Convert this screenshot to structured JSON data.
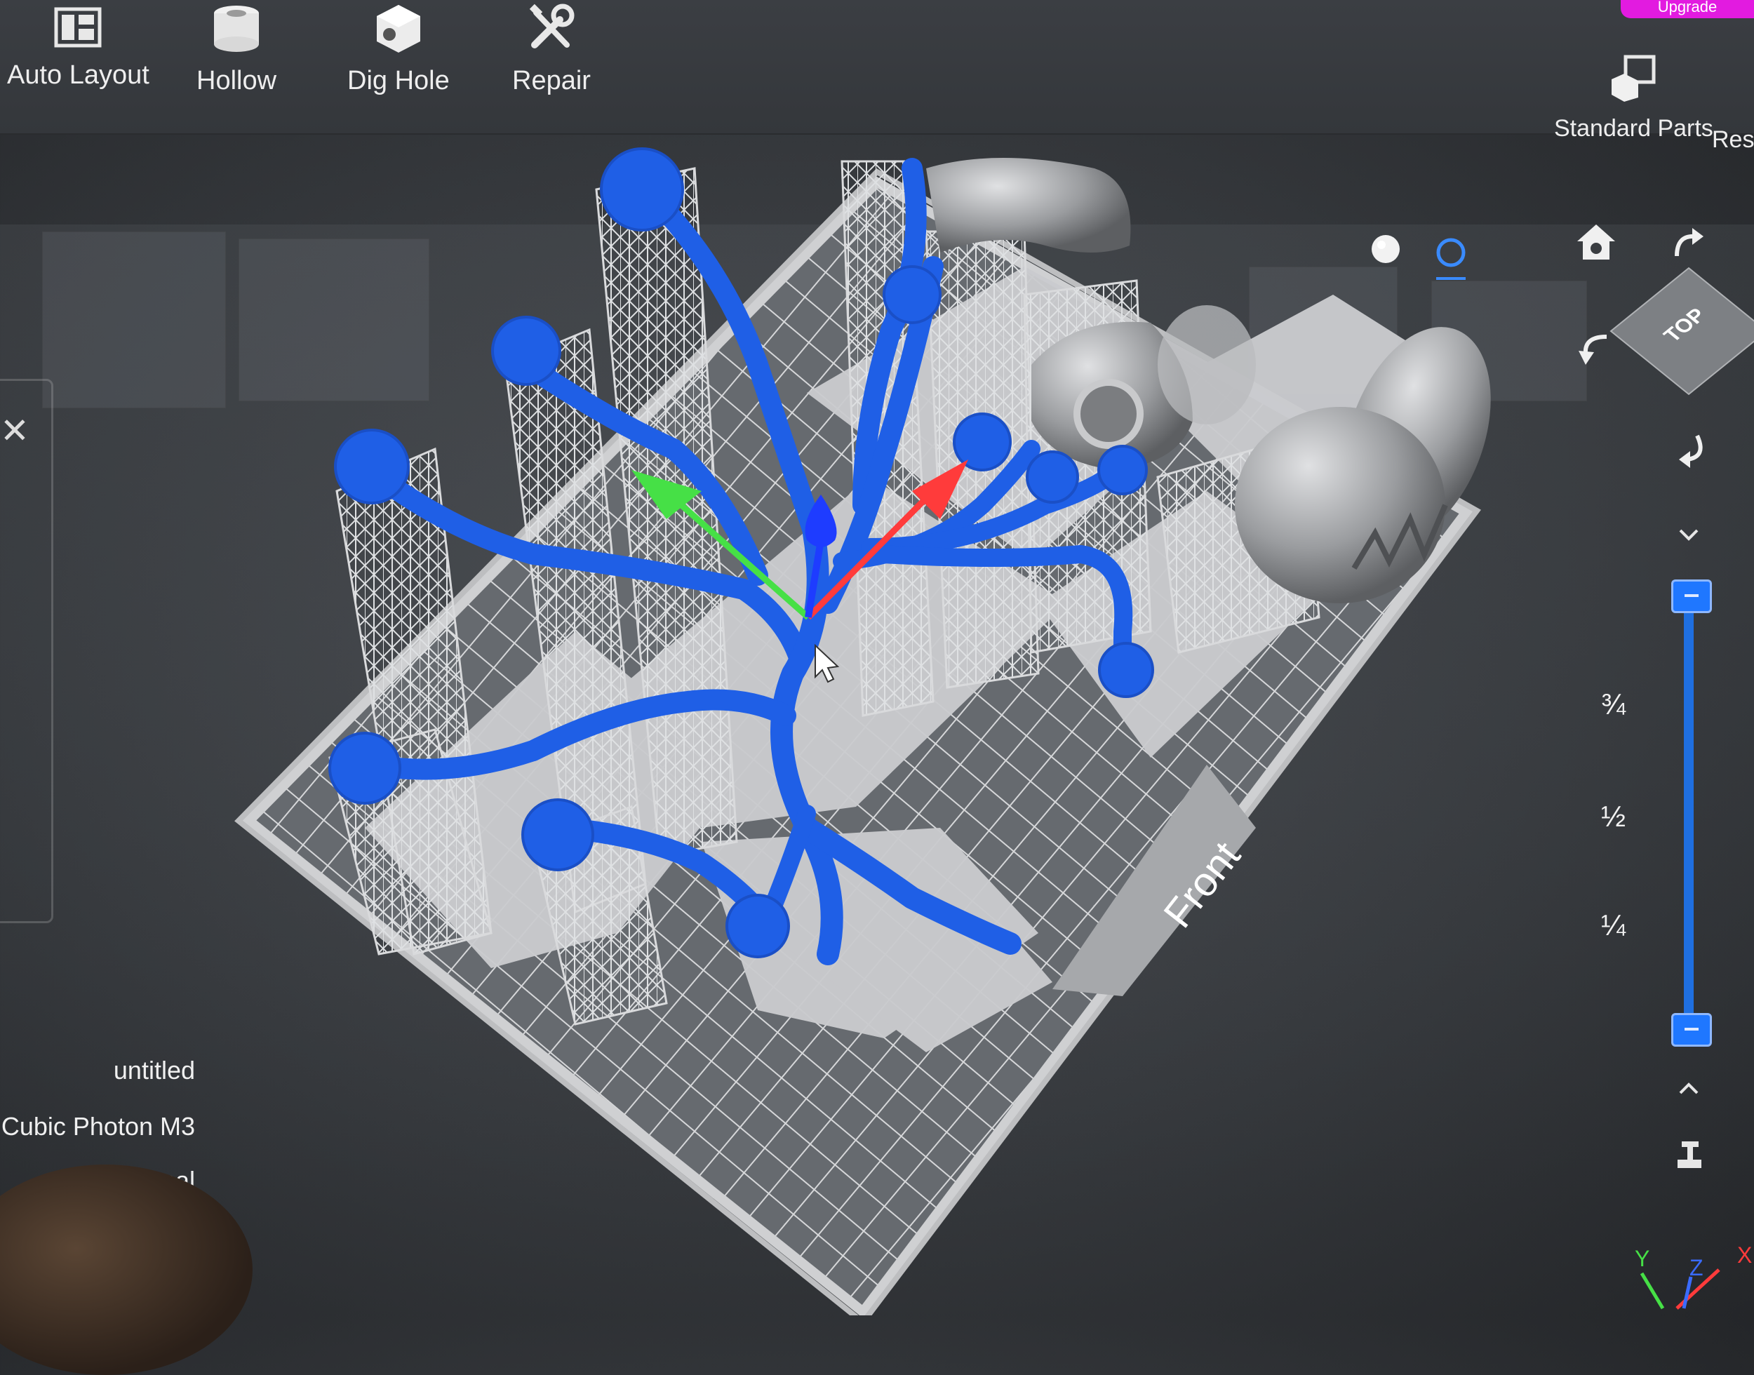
{
  "toolbar": {
    "items": [
      {
        "label": "Auto Layout",
        "icon": "auto-layout-icon"
      },
      {
        "label": "Hollow",
        "icon": "hollow-icon"
      },
      {
        "label": "Dig Hole",
        "icon": "dig-hole-icon"
      },
      {
        "label": "Repair",
        "icon": "repair-icon"
      }
    ],
    "right_items": [
      {
        "label": "Standard Parts",
        "icon": "standard-parts-icon"
      },
      {
        "label": "Resi",
        "icon": "resin-icon"
      }
    ],
    "upgrade_label": "Upgrade"
  },
  "viewport": {
    "plate_label": "Front",
    "view_cube_label": "TOP",
    "shading_modes": [
      "solid-shading-icon",
      "wireframe-shading-icon"
    ],
    "colors": {
      "selected_model": "#1f5fe6",
      "supports": "#cfd1d4",
      "models": "#9a9c9f",
      "build_plate": "#c9cacc",
      "axis_x": "#ff3b3b",
      "axis_y": "#46e046",
      "axis_z": "#1e3cff"
    }
  },
  "layer_slider": {
    "fractions": [
      "3/4",
      "1/2",
      "1/4"
    ],
    "fraction_glyphs": [
      "¾",
      "½",
      "¼"
    ],
    "up_label": "^",
    "down_label": "v"
  },
  "info": {
    "project": "untitled",
    "printer": "Cubic Photon M3",
    "profile": "normal"
  },
  "axis_triad": {
    "x": "X",
    "y": "Y",
    "z": "Z"
  }
}
